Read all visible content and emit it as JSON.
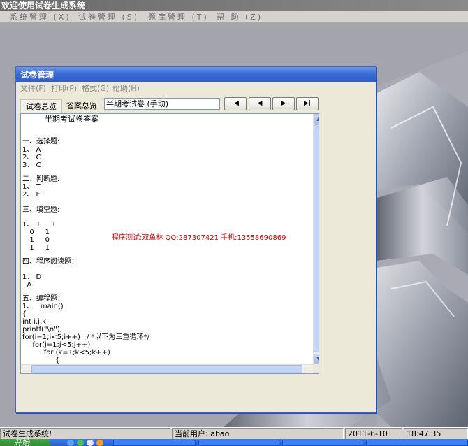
{
  "app": {
    "title": "欢迎使用试卷生成系统",
    "menu": [
      "系统管理 (X)",
      "试卷管理 (S)",
      "题库管理 (T)",
      "帮 助 (Z)"
    ]
  },
  "child": {
    "title": "试卷管理",
    "menu": [
      "文件(F)",
      "打印(P)",
      "格式(G)",
      "帮助(H)"
    ],
    "tabs": [
      "试卷总览",
      "答案总览"
    ],
    "selected_document": "半期考试卷 (手动)",
    "nav_buttons": {
      "first": "first-record-icon",
      "prev": "previous-record-icon",
      "next": "next-record-icon",
      "last": "last-record-icon"
    },
    "content": {
      "heading": "半期考试卷答案",
      "lines": [
        "一、选择题:",
        "1、 A",
        "2、 C",
        "3、 C",
        "二、判断题:",
        "1、 T",
        "2、 F",
        "三、填空题:",
        "1、 1     1",
        "  0     1",
        "  1     0",
        "  1     1",
        "四、程序阅读题：",
        "1、 D",
        "  A",
        "五、编程题：",
        "1、   main()",
        "{",
        "int i,j,k;",
        "printf(\"\\n\");",
        "for(i=1;i<5;i++)",
        "  for(j=1;j<5;j++)",
        "    for (k=1;k<5;k++)",
        "      {"
      ],
      "comment": "/ *以下为三重循环*/",
      "watermark": "程序测试:双鱼林 QQ:287307421 手机:13558690869"
    }
  },
  "status": {
    "app_name": "试卷生成系统!",
    "current_user": "当前用户: abao",
    "date": "2011-6-10",
    "time": "18:47:35"
  },
  "taskbar": {
    "start_label": "开始"
  },
  "colors": {
    "watermark": "#d40000",
    "child_title": "#2d5cc4"
  }
}
